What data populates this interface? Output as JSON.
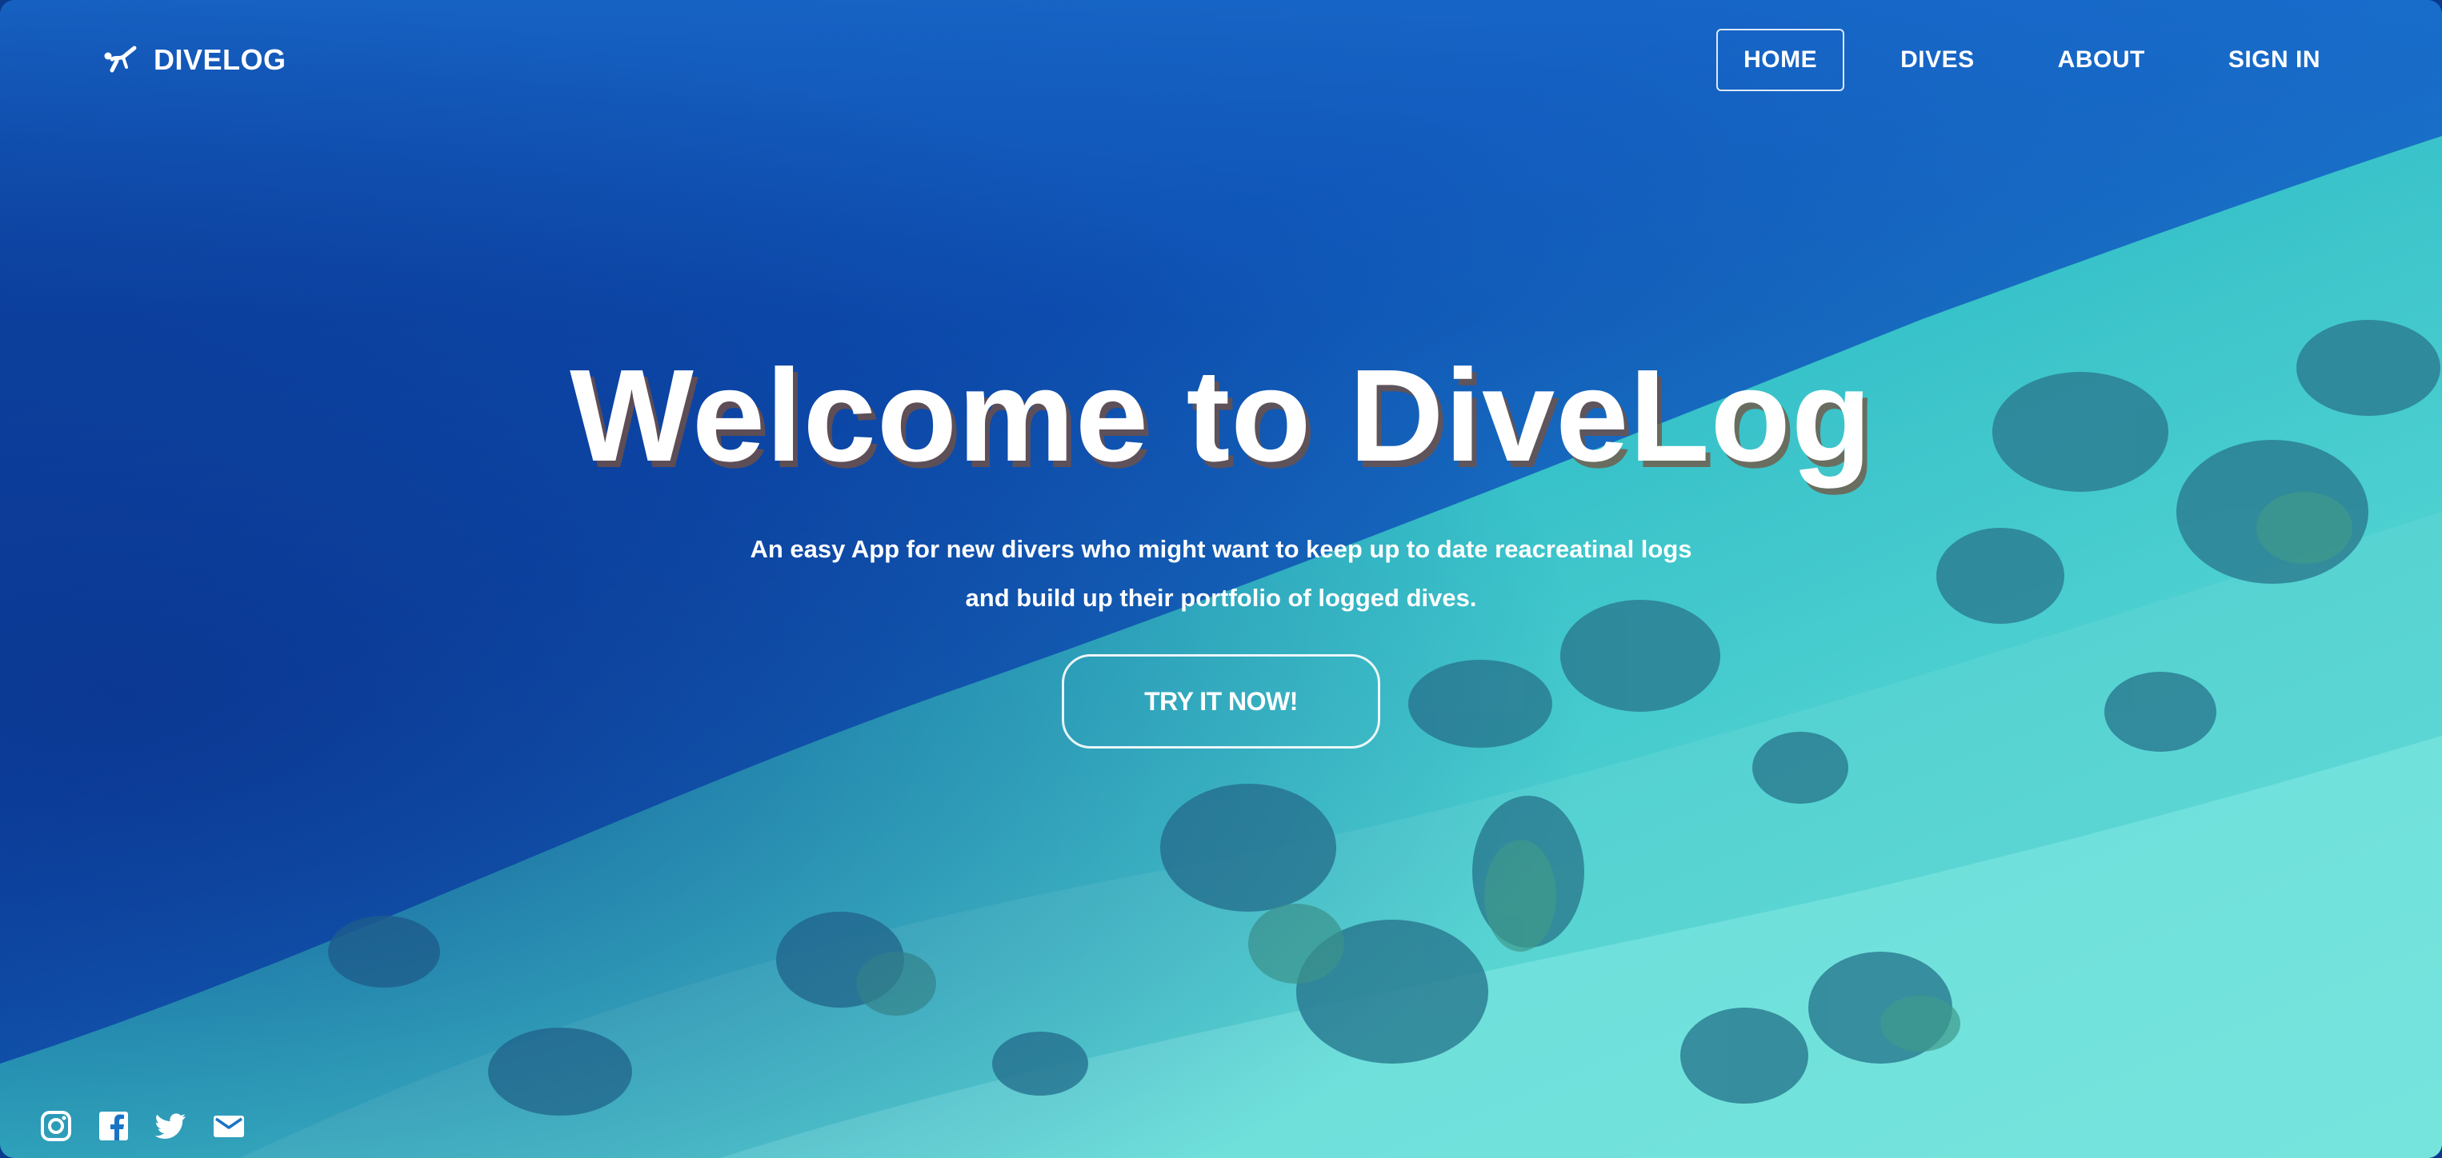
{
  "navbar": {
    "brand": "DIVELOG",
    "brand_icon": "diver-icon",
    "links": [
      {
        "label": "HOME",
        "active": true
      },
      {
        "label": "DIVES",
        "active": false
      },
      {
        "label": "ABOUT",
        "active": false
      },
      {
        "label": "SIGN IN",
        "active": false
      }
    ]
  },
  "hero": {
    "title": "Welcome to DiveLog",
    "subtitle_line1": "An easy App for new divers who might want to keep up to date reacreatinal logs",
    "subtitle_line2": "and build up their portfolio of logged dives.",
    "cta_label": "TRY IT NOW!"
  },
  "social": {
    "icons": [
      "instagram-icon",
      "facebook-icon",
      "twitter-icon",
      "email-icon"
    ]
  },
  "colors": {
    "deep_blue": "#0b3f9c",
    "mid_blue": "#1a62c7",
    "turquoise": "#35c9c9",
    "sand": "#6fe0d8",
    "text": "#ffffff",
    "title_shadow": "#7a5040"
  }
}
